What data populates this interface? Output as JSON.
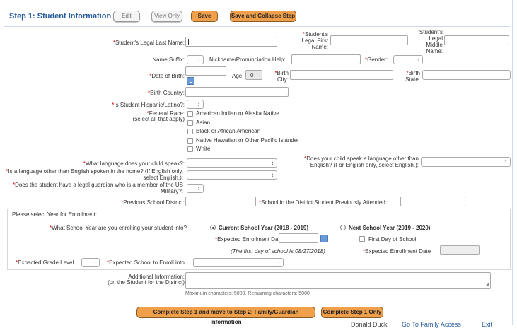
{
  "header": {
    "title": "Step 1: Student Information",
    "edit": "Edit",
    "view_only": "View Only",
    "save": "Save",
    "save_collapse": "Save and Collapse Step"
  },
  "fields": {
    "last_name": "Student's Legal Last Name:",
    "first_name": "Student's Legal First Name:",
    "middle_name": "Student's Legal Middle Name:",
    "name_suffix": "Name Suffix:",
    "nickname": "Nickname/Pronunciation Help:",
    "gender": "Gender:",
    "dob": "Date of Birth:",
    "age": "Age:",
    "age_value": "0",
    "birth_city": "Birth City:",
    "birth_state": "Birth State:",
    "birth_country": "Birth Country:",
    "hispanic": "Is Student Hispanic/Latino?:",
    "federal_race": "Federal Race:",
    "federal_race_note": "(select all that apply)",
    "language_speak": "What language does your child speak?:",
    "language_other": "Does your child speak a language other than English? (For English only, select English.):",
    "language_home": "Is a language other than English spoken in the home? (If English only, select English.):",
    "military": "Does the student have a legal guardian who is a member of the US Military?:",
    "prev_district": "Previous School District:",
    "prev_school": "School in the District Student Previously Attended:"
  },
  "race_options": [
    "American Indian or Alaska Native",
    "Asian",
    "Black or African American",
    "Native Hawaiian or Other Pacific Islander",
    "White"
  ],
  "enrollment": {
    "heading": "Please select Year for Enrollment:",
    "question": "What School Year are you enrolling your student into?",
    "current_year": "Current School Year (2018 - 2019)",
    "next_year": "Next School Year (2019 - 2020)",
    "expected_date": "Expected Enrollment Date",
    "first_day_school": "First Day of School",
    "first_day_note": "(The first day of school is 08/27/2018)",
    "expected_date_2": "Expected Enrollment Date",
    "grade_level": "Expected Grade Level",
    "school_enroll": "Expected School to Enroll into"
  },
  "additional": {
    "label": "Additional Information:",
    "sublabel": "(on the Student for the District)",
    "counter": "Maximum characters: 5000, Remaining characters: 5000"
  },
  "footer": {
    "complete_move": "Complete Step 1 and move to Step 2: Family/Guardian Information",
    "complete_only": "Complete Step 1 Only",
    "user": "Donald Duck",
    "family_access": "Go To Family Access",
    "exit": "Exit"
  },
  "colors": {
    "title": "#2a5d9f",
    "accent_orange": "#f0a04b",
    "required": "#dd0000",
    "calendar": "#6a9bd8"
  }
}
